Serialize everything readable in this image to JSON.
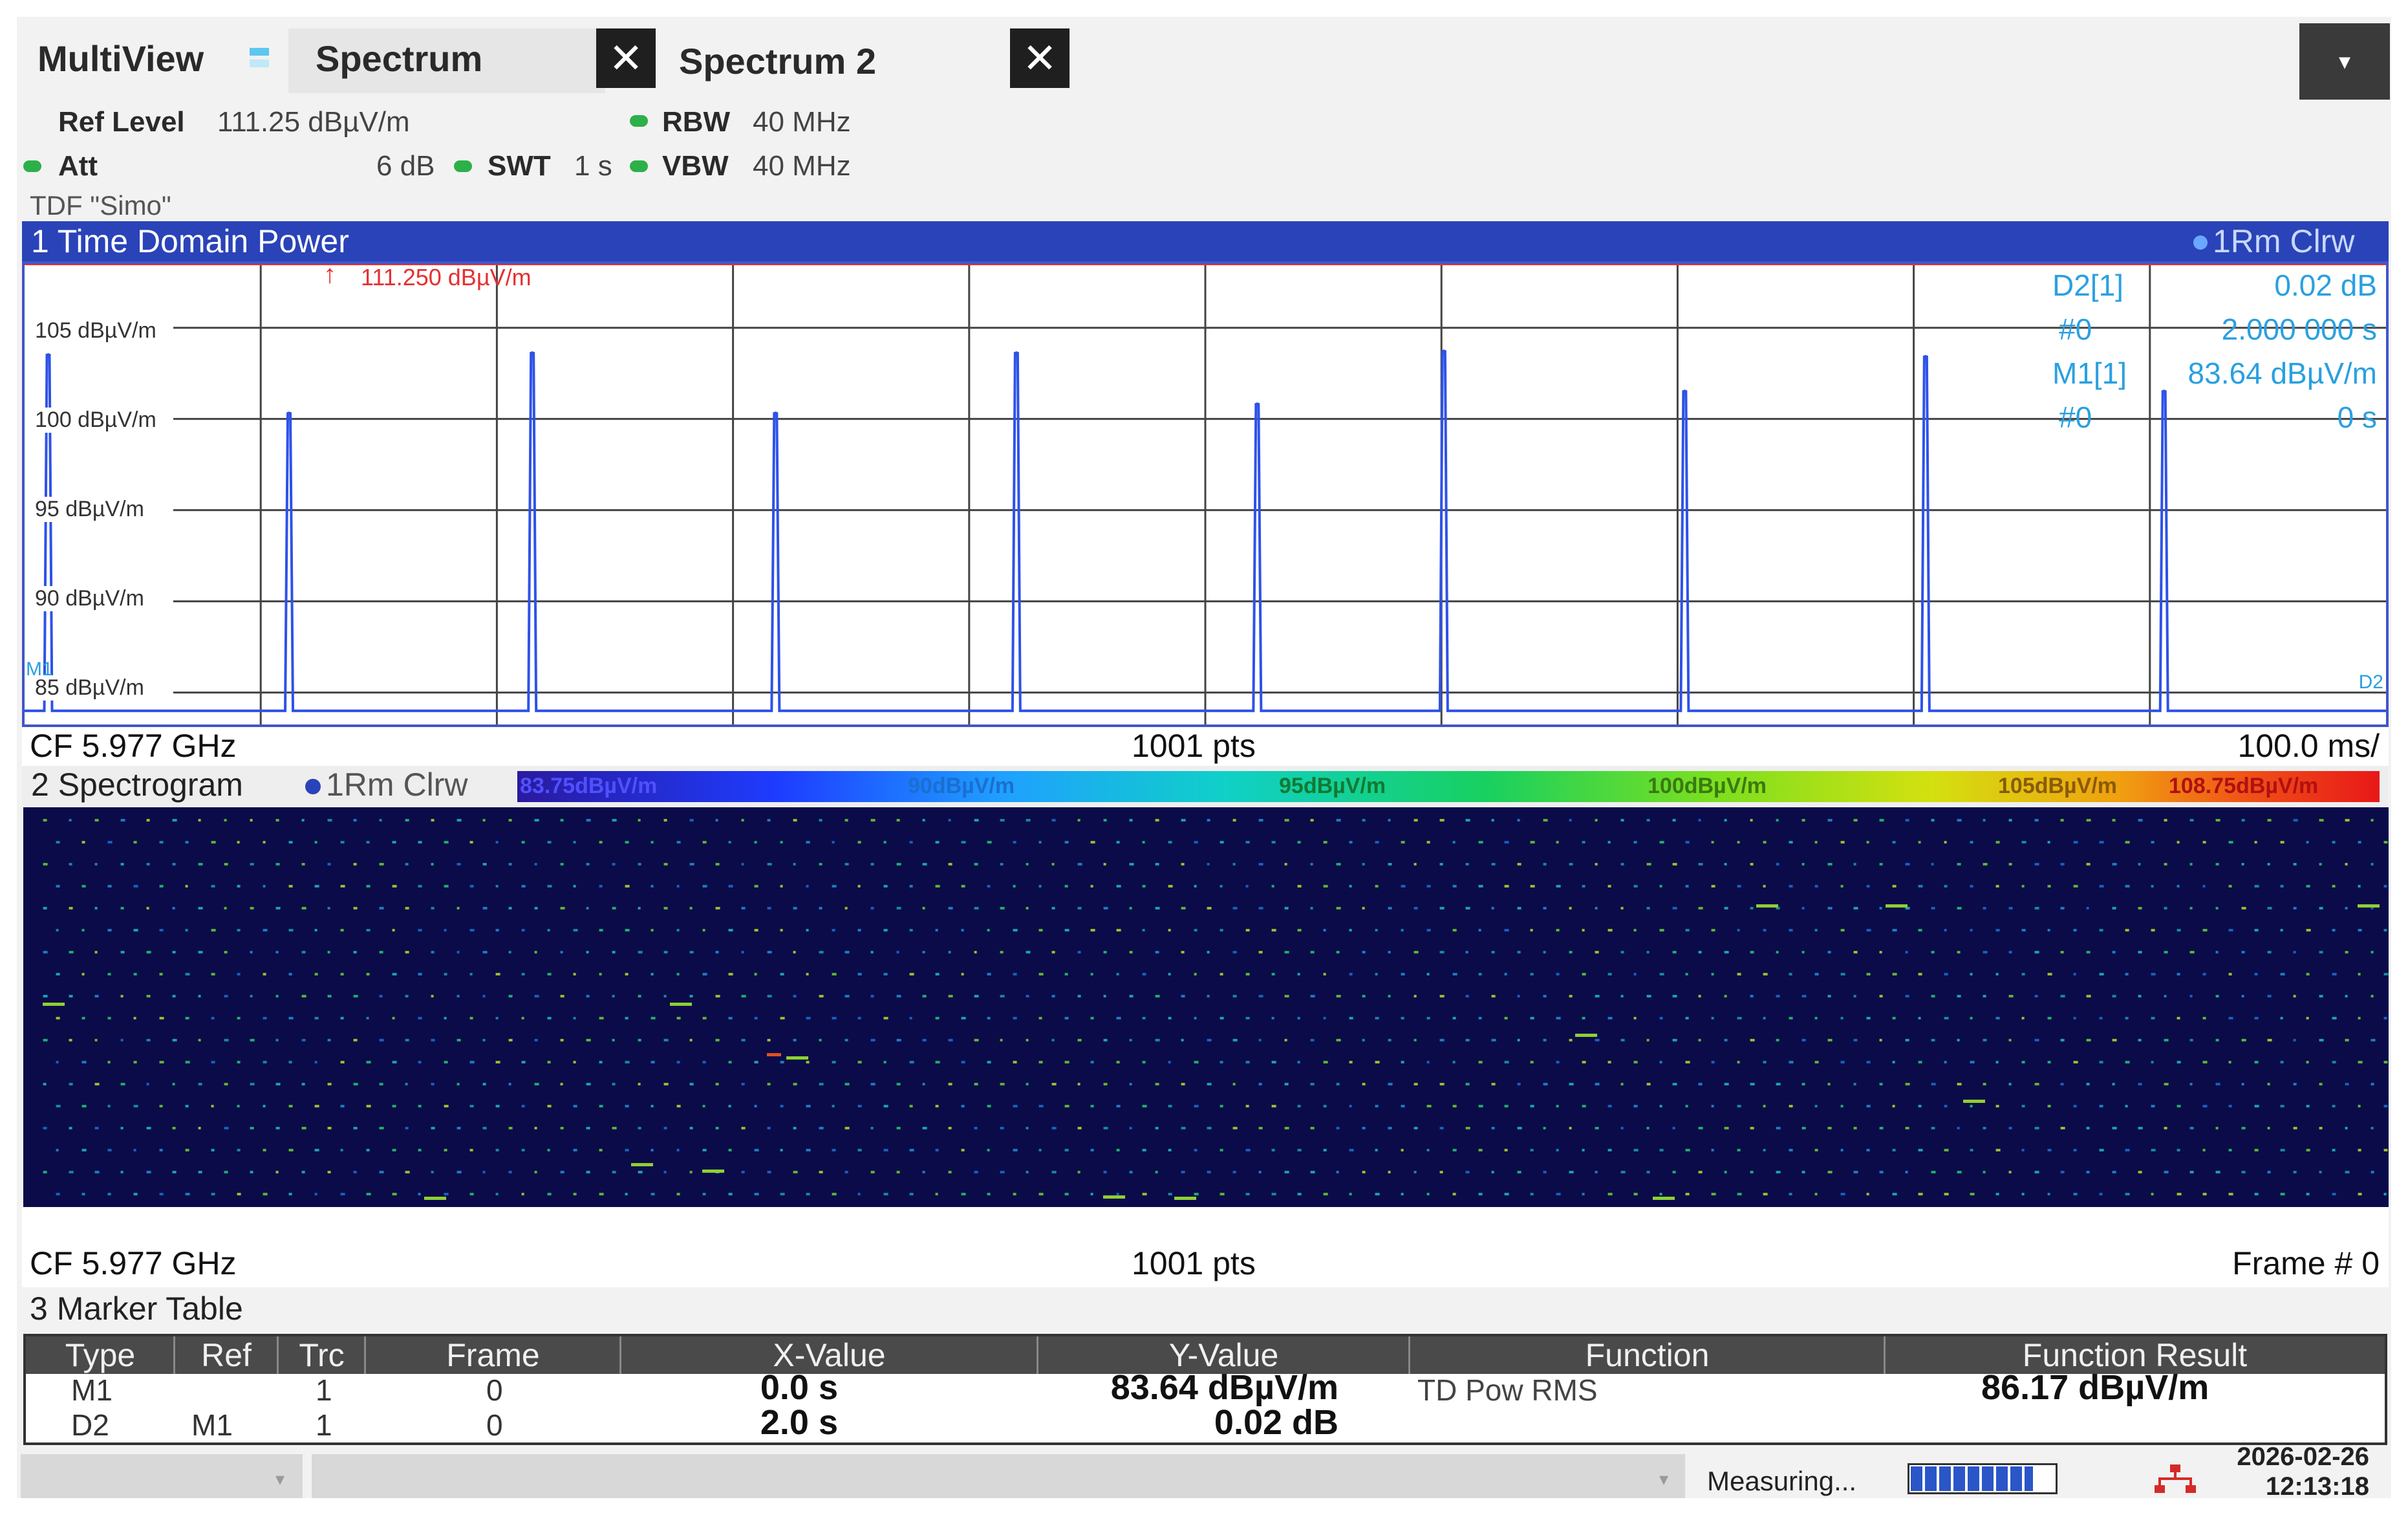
{
  "tabs": {
    "multiview": "MultiView",
    "spectrum": "Spectrum",
    "spectrum2": "Spectrum 2",
    "close_glyph": "✕",
    "menu_glyph": "▾"
  },
  "settings": {
    "ref_level_label": "Ref Level",
    "ref_level_value": "111.25 dBµV/m",
    "att_label": "Att",
    "att_value": "6 dB",
    "swt_label": "SWT",
    "swt_value": "1 s",
    "rbw_label": "RBW",
    "rbw_value": "40 MHz",
    "vbw_label": "VBW",
    "vbw_value": "40 MHz",
    "tdf": "TDF \"Simo\""
  },
  "window1": {
    "title": "1 Time Domain Power",
    "trace": "1Rm Clrw",
    "ref_marker": "111.250 dBµV/m",
    "ref_arrow": "↑",
    "y_ticks": [
      "105 dBµV/m",
      "100 dBµV/m",
      "95 dBµV/m",
      "90 dBµV/m",
      "85 dBµV/m"
    ],
    "marker_info": {
      "d2_label": "D2[1]",
      "d2_value": "0.02 dB",
      "d2_sub_label": "#0",
      "d2_sub_value": "2.000 000 s",
      "m1_label": "M1[1]",
      "m1_value": "83.64 dBµV/m",
      "m1_sub_label": "#0",
      "m1_sub_value": "0 s"
    },
    "m1_tag": "M1",
    "d2_tag": "D2",
    "footer_cf": "CF 5.977 GHz",
    "footer_pts": "1001 pts",
    "footer_div": "100.0 ms/"
  },
  "chart_data": {
    "type": "line",
    "title": "1 Time Domain Power",
    "ylabel": "",
    "xlabel": "",
    "y_unit": "dBµV/m",
    "ylim": [
      83.25,
      108.5
    ],
    "xlim": [
      0,
      1000
    ],
    "x_unit": "ms",
    "grid": true,
    "series": [
      {
        "name": "1Rm Clrw",
        "peaks_x": [
          10,
          112,
          215,
          318,
          420,
          522,
          601,
          703,
          805,
          906
        ],
        "peaks_y": [
          103.5,
          100.3,
          103.6,
          100.3,
          103.6,
          100.8,
          103.7,
          101.5,
          103.4,
          101.5
        ],
        "baseline": 84.0
      }
    ]
  },
  "window2": {
    "title": "2 Spectrogram",
    "trace": "1Rm Clrw",
    "colorbar": [
      "83.75dBµV/m",
      "90dBµV/m",
      "95dBµV/m",
      "100dBµV/m",
      "105dBµV/m",
      "108.75dBµV/m"
    ],
    "footer_cf": "CF 5.977 GHz",
    "footer_pts": "1001 pts",
    "footer_frame": "Frame # 0"
  },
  "marker_table": {
    "title": "3 Marker Table",
    "headers": [
      "Type",
      "Ref",
      "Trc",
      "Frame",
      "X-Value",
      "Y-Value",
      "Function",
      "Function Result"
    ],
    "rows": [
      {
        "type": "M1",
        "ref": "",
        "trc": "1",
        "frame": "0",
        "x": "0.0 s",
        "y": "83.64 dBµV/m",
        "function": "TD Pow RMS",
        "result": "86.17 dBµV/m"
      },
      {
        "type": "D2",
        "ref": "M1",
        "trc": "1",
        "frame": "0",
        "x": "2.0 s",
        "y": "0.02 dB",
        "function": "",
        "result": ""
      }
    ]
  },
  "status": {
    "measuring": "Measuring...",
    "progress_fraction": 0.85,
    "date": "2026-02-26",
    "time": "12:13:18"
  }
}
